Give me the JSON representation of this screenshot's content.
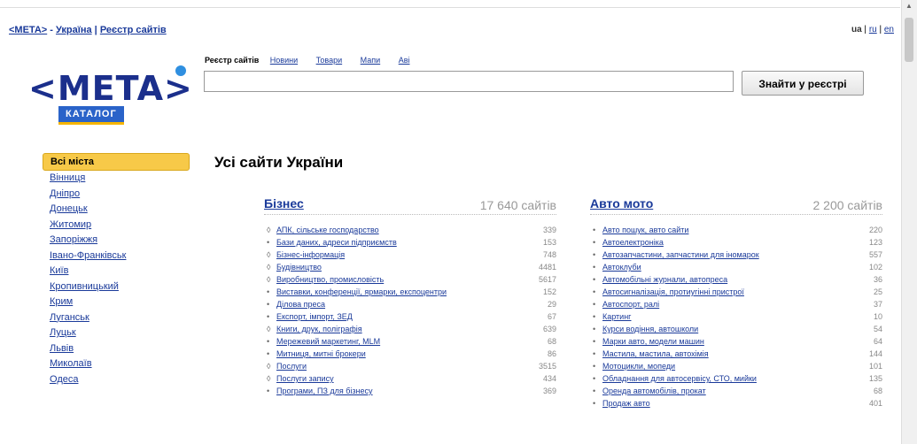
{
  "breadcrumb": {
    "site": "<META>",
    "sep1": " - ",
    "country": "Україна",
    "sep2": " | ",
    "section": "Реєстр сайтів"
  },
  "langs": {
    "ua": "ua",
    "ru": "ru",
    "en": "en"
  },
  "logo": {
    "text": "<META>",
    "badge": "КАТАЛОГ"
  },
  "search": {
    "tabs_active": "Реєстр сайтів",
    "tabs": [
      "Новини",
      "Товари",
      "Мапи",
      "Аві"
    ],
    "value": "",
    "button_label": "Знайти у реєстрі"
  },
  "cities": {
    "active": "Всі міста",
    "items": [
      "Вінниця",
      "Дніпро",
      "Донецьк",
      "Житомир",
      "Запоріжжя",
      "Івано-Франківськ",
      "Київ",
      "Кропивницький",
      "Крим",
      "Луганськ",
      "Луцьк",
      "Львів",
      "Миколаїв",
      "Одеса"
    ]
  },
  "page_title": "Усі сайти України",
  "categories": [
    {
      "name": "Бізнес",
      "count": "17 640 сайтів",
      "items": [
        {
          "label": "АПК, сільське господарство",
          "count": "339",
          "icon": "folder-icon"
        },
        {
          "label": "Бази даних, адреси підприємств",
          "count": "153",
          "icon": "bullet"
        },
        {
          "label": "Бізнес-інформація",
          "count": "748",
          "icon": "folder-icon"
        },
        {
          "label": "Будівництво",
          "count": "4481",
          "icon": "folder-icon"
        },
        {
          "label": "Виробництво, промисловість",
          "count": "5617",
          "icon": "folder-icon"
        },
        {
          "label": "Виставки, конференції, ярмарки, експоцентри",
          "count": "152",
          "icon": "bullet"
        },
        {
          "label": "Ділова преса",
          "count": "29",
          "icon": "bullet"
        },
        {
          "label": "Експорт, імпорт, ЗЕД",
          "count": "67",
          "icon": "bullet"
        },
        {
          "label": "Книги, друк, поліграфія",
          "count": "639",
          "icon": "folder-icon"
        },
        {
          "label": "Мережевий маркетинг, MLM",
          "count": "68",
          "icon": "bullet"
        },
        {
          "label": "Митниця, митні брокери",
          "count": "86",
          "icon": "bullet"
        },
        {
          "label": "Послуги",
          "count": "3515",
          "icon": "folder-icon"
        },
        {
          "label": "Послуги запису",
          "count": "434",
          "icon": "folder-icon"
        },
        {
          "label": "Програми, ПЗ для бізнесу",
          "count": "369",
          "icon": "bullet"
        }
      ]
    },
    {
      "name": "Авто мото",
      "count": "2 200 сайтів",
      "items": [
        {
          "label": "Авто пошук, авто сайти",
          "count": "220",
          "icon": "bullet"
        },
        {
          "label": "Автоелектроніка",
          "count": "123",
          "icon": "bullet"
        },
        {
          "label": "Автозапчастини, запчастини для іномарок",
          "count": "557",
          "icon": "bullet"
        },
        {
          "label": "Автоклуби",
          "count": "102",
          "icon": "bullet"
        },
        {
          "label": "Автомобільні журнали, автопреса",
          "count": "36",
          "icon": "bullet"
        },
        {
          "label": "Автосигналізація, протиугінні пристрої",
          "count": "25",
          "icon": "bullet"
        },
        {
          "label": "Автоспорт, ралі",
          "count": "37",
          "icon": "bullet"
        },
        {
          "label": "Картинг",
          "count": "10",
          "icon": "bullet"
        },
        {
          "label": "Курси водіння, автошколи",
          "count": "54",
          "icon": "bullet"
        },
        {
          "label": "Марки авто, модели машин",
          "count": "64",
          "icon": "bullet"
        },
        {
          "label": "Мастила, мастила, автохімія",
          "count": "144",
          "icon": "bullet"
        },
        {
          "label": "Мотоцикли, мопеди",
          "count": "101",
          "icon": "bullet"
        },
        {
          "label": "Обладнання для автосервісу, СТО, мийки",
          "count": "135",
          "icon": "bullet"
        },
        {
          "label": "Оренда автомобілів, прокат",
          "count": "68",
          "icon": "bullet"
        },
        {
          "label": "Продаж авто",
          "count": "401",
          "icon": "bullet"
        }
      ]
    }
  ]
}
